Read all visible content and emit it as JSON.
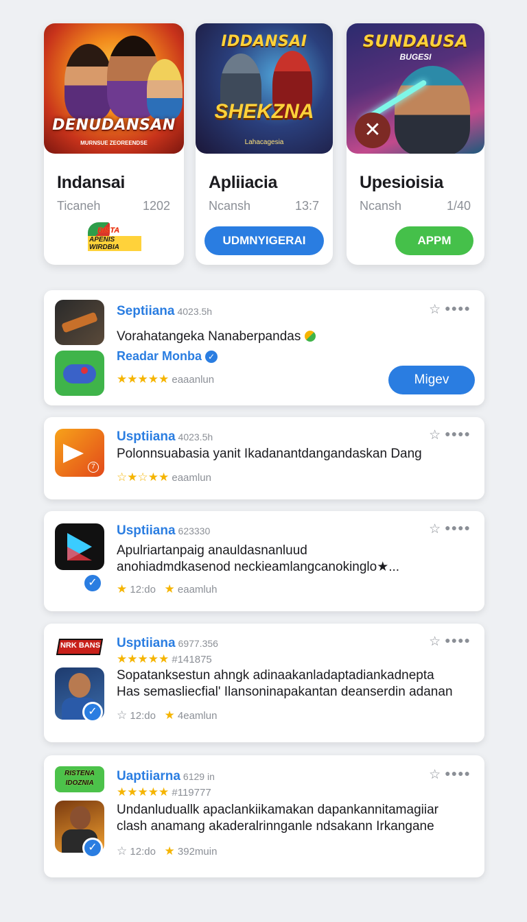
{
  "apps": [
    {
      "art_title": "DENUDANSAN",
      "art_subtitle": "MURNSUE ZEOREENDSE",
      "name": "Indansai",
      "meta_left": "Ticaneh",
      "meta_right": "1202",
      "logo_text_top": "BISTA",
      "logo_text_bottom": "APENIS WIRDBIA"
    },
    {
      "art_title": "IDDANSAI",
      "art_title_2": "SHEKZNA",
      "art_subtitle": "Lahacagesia",
      "name": "Apliiacia",
      "meta_left": "Ncansh",
      "meta_right": "13:7",
      "button_label": "UDMNYIGERAI"
    },
    {
      "art_title": "SUNDAUSA",
      "art_subtitle": "BUGESI",
      "badge_icon": "✕",
      "name": "Upesioisia",
      "meta_left": "Ncansh",
      "meta_right": "1/40",
      "button_label": "APPM"
    }
  ],
  "reviews": [
    {
      "author": "Septiiana",
      "code": "4023.5h",
      "text": "Vorahatangeka Nanaberpandas",
      "sub_author": "Readar Monba",
      "rating_stars": "★★★★★",
      "rating_label": "eaaanlun",
      "button_label": "Migev"
    },
    {
      "author": "Usptiiana",
      "code": "4023.5h",
      "text": "Polonnsuabasia yanit Ikadanantdangandaskan Dang",
      "rating_stars": "☆★☆★★",
      "rating_label": "eaamlun",
      "tile_badge": "7"
    },
    {
      "author": "Usptiiana",
      "code": "623330",
      "text": "Apulriartanpaig anauldasnanluud anohiadmdkasenod neckieamlangcanokinglo★...",
      "time": "12:do",
      "rating_label": "eaamluh"
    },
    {
      "author": "Usptiiana",
      "code": "6977.356",
      "rating_stars": "★★★★★",
      "tag": "#141875",
      "text": "Sopatanksestun ahngk adinaakanladaptadiankadnepta Has semasliecfial' Ilansoninapakantan deanserdin adanan",
      "time": "12:do",
      "rating_label": "4eamlun",
      "tile_logo": "NRK BANS"
    },
    {
      "author": "Uaptiiarna",
      "code": "6129 in",
      "rating_stars": "★★★★★",
      "tag": "#119777",
      "text": "Undanluduallk apaclankiikamakan dapankannitamagiiar clash anamang akaderalrinnganle ndsakann Irkangane",
      "time": "12:do",
      "rating_label": "392muin",
      "tile_logo": "RISTENA IDOZNIA"
    }
  ],
  "colors": {
    "accent_blue": "#2a7de1",
    "accent_green": "#45c04a",
    "star_gold": "#f5b400",
    "background": "#eef0f3"
  },
  "icons": {
    "favorite": "star-outline-icon",
    "more": "more-dots-icon",
    "verified": "verified-check-icon"
  }
}
